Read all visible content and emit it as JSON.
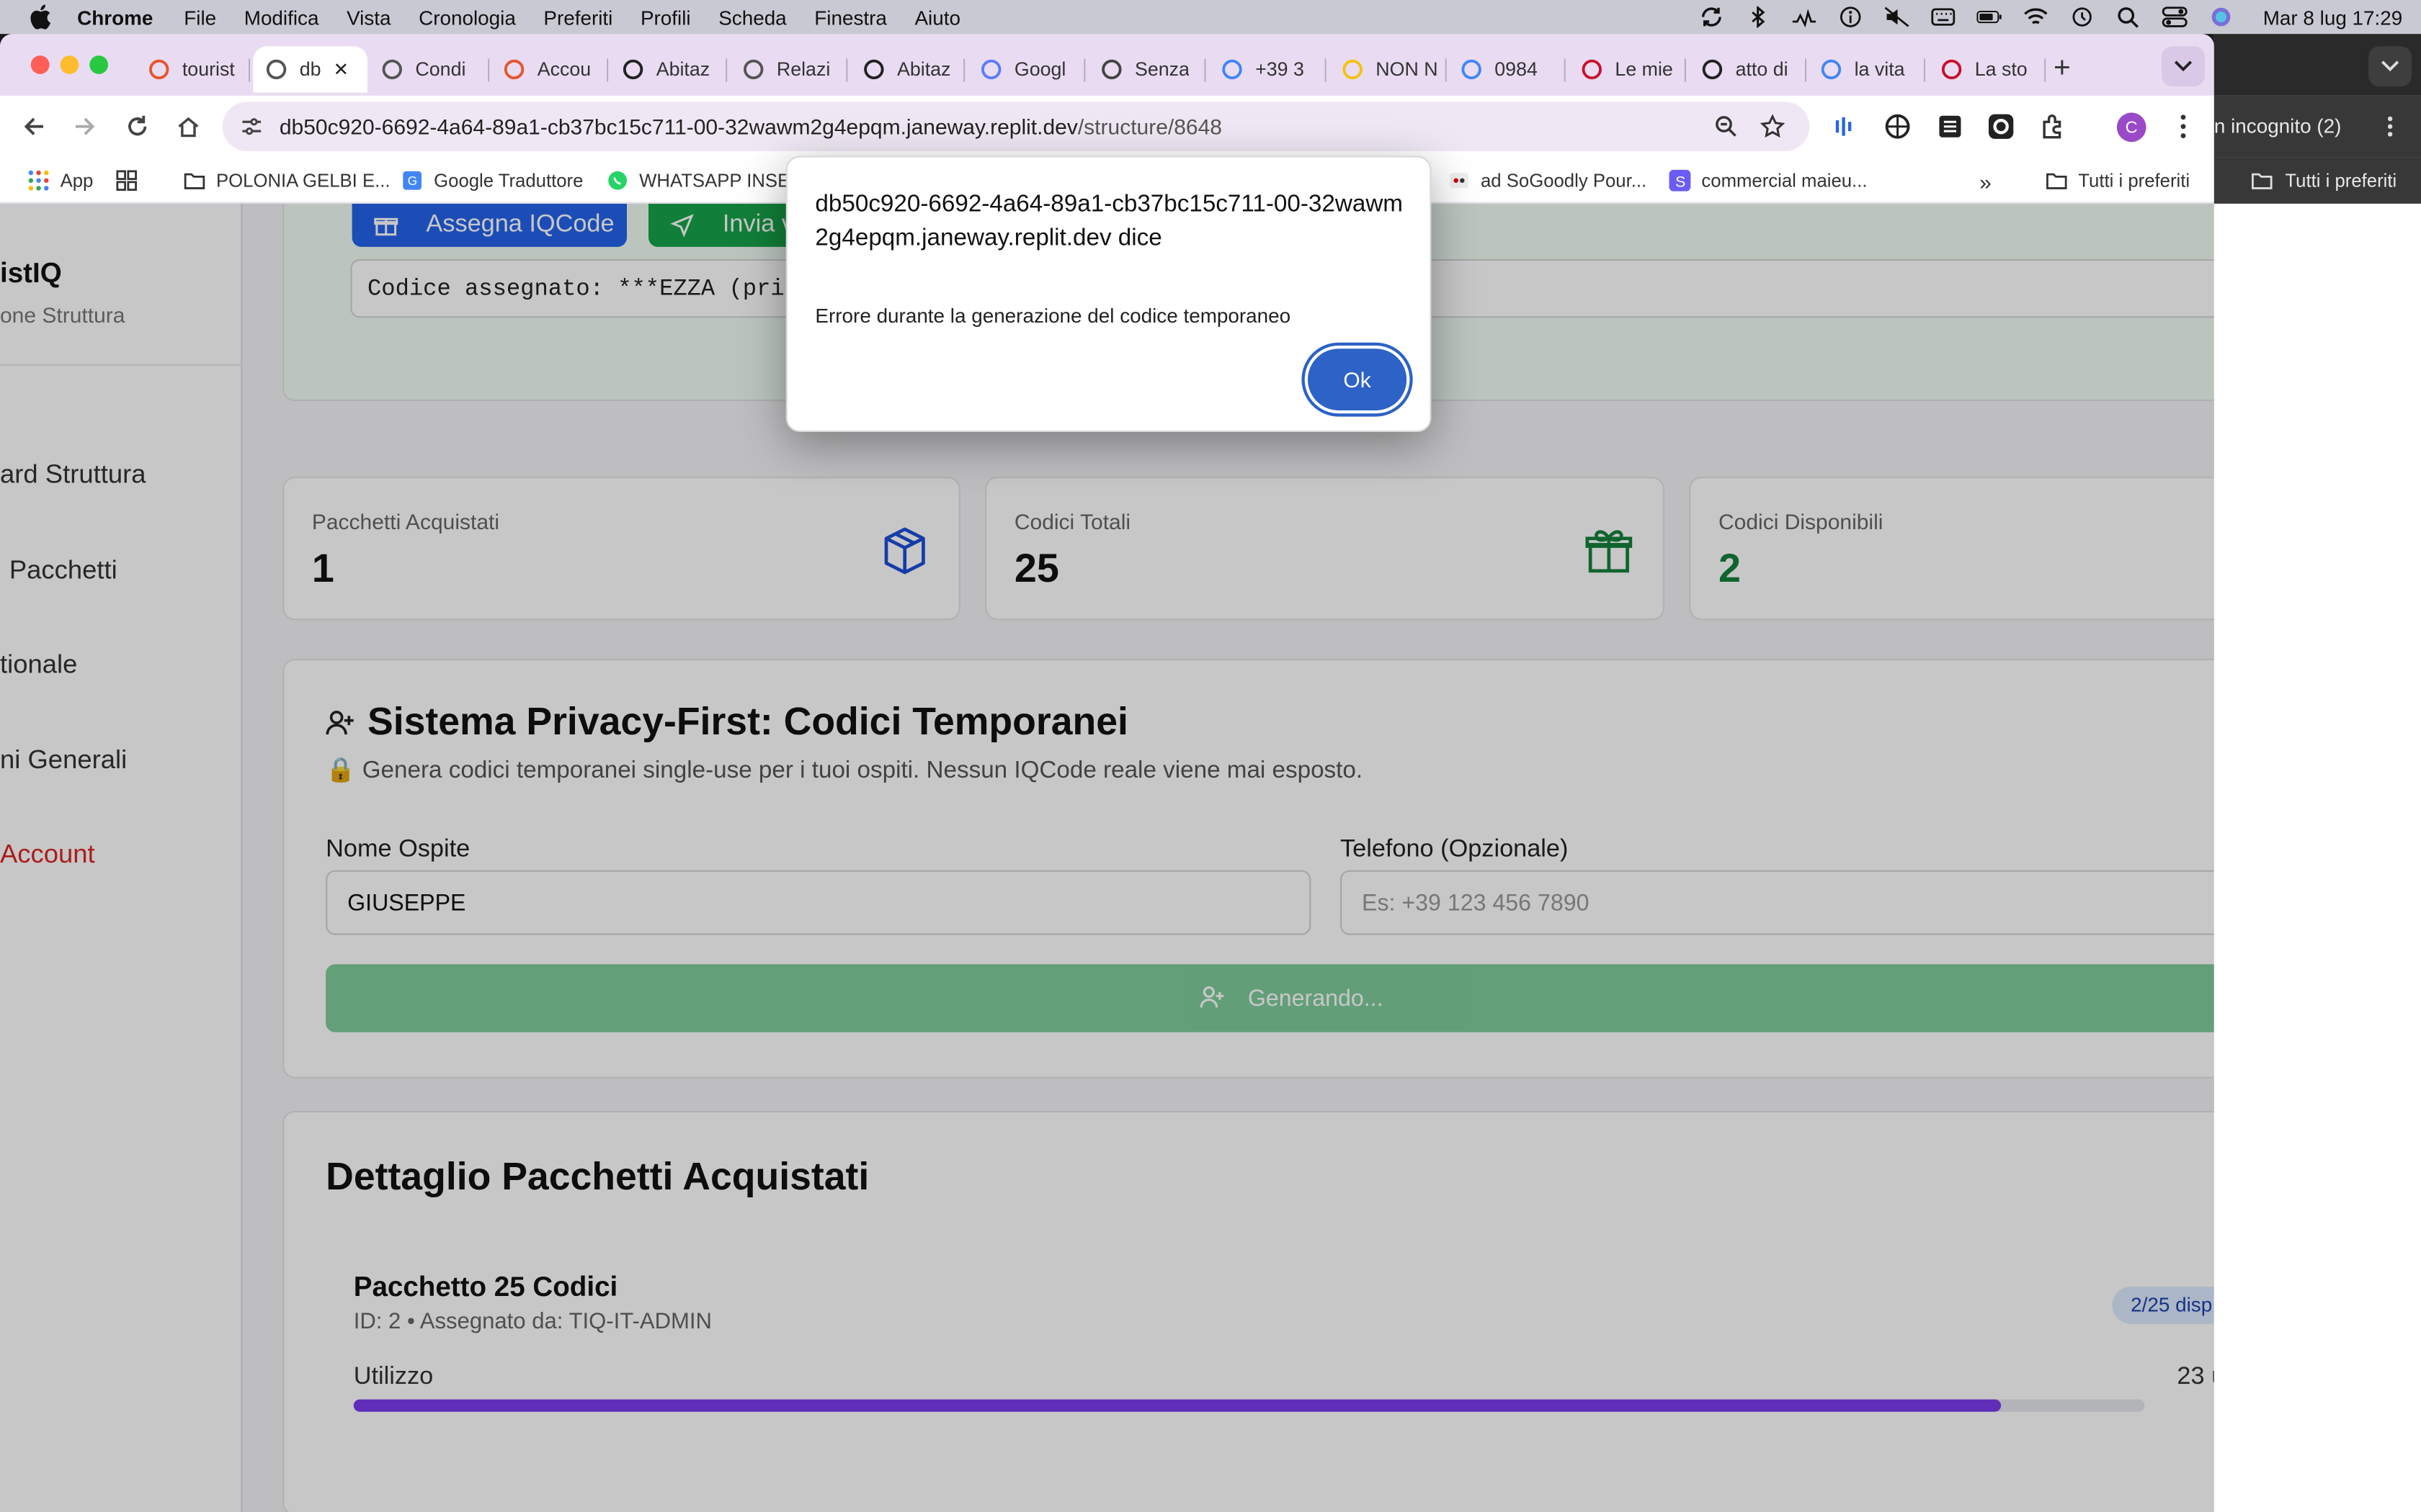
{
  "menubar": {
    "app": "Chrome",
    "items": [
      "File",
      "Modifica",
      "Vista",
      "Cronologia",
      "Preferiti",
      "Profili",
      "Scheda",
      "Finestra",
      "Aiuto"
    ],
    "clock": "Mar 8 lug  17:29"
  },
  "tabs": [
    {
      "label": "tourist",
      "active": false
    },
    {
      "label": "db",
      "active": true
    },
    {
      "label": "Condi",
      "active": false
    },
    {
      "label": "Accou",
      "active": false
    },
    {
      "label": "Abitaz",
      "active": false
    },
    {
      "label": "Relazi",
      "active": false
    },
    {
      "label": "Abitaz",
      "active": false
    },
    {
      "label": "Googl",
      "active": false
    },
    {
      "label": "Senza",
      "active": false
    },
    {
      "label": "+39 3",
      "active": false
    },
    {
      "label": "NON N",
      "active": false
    },
    {
      "label": "0984",
      "active": false
    },
    {
      "label": "Le mie",
      "active": false
    },
    {
      "label": "atto di",
      "active": false
    },
    {
      "label": "la vita",
      "active": false
    },
    {
      "label": "La sto",
      "active": false
    }
  ],
  "address": {
    "host": "db50c920-6692-4a64-89a1-cb37bc15c711-00-32wawm2g4epqm.janeway.replit.dev",
    "path": "/structure/8648"
  },
  "avatar_letter": "C",
  "bookmarks": [
    "App",
    "POLONIA GELBI E...",
    "Google Traduttore",
    "WHATSAPP INSER",
    "ad SoGoodly Pour...",
    "commercial maieu...",
    "Tutti i preferiti"
  ],
  "incognito": {
    "label": "n incognito (2)",
    "bookmarks_label": "Tutti i preferiti"
  },
  "sidebar": {
    "title": "istIQ",
    "subtitle": "one Struttura",
    "items": [
      "ard Struttura",
      "Pacchetti",
      "tionale",
      "ni Generali",
      "Account"
    ]
  },
  "assign": {
    "assign_button": "Assegna IQCode",
    "send_button": "Invia v",
    "code_text": "Codice assegnato: ***EZZA (pri"
  },
  "stats": [
    {
      "label": "Pacchetti Acquistati",
      "value": "1",
      "icon": "box-icon",
      "color": "#1d4ed8"
    },
    {
      "label": "Codici Totali",
      "value": "25",
      "icon": "gift-icon",
      "color": "#15803d"
    },
    {
      "label": "Codici Disponibili",
      "value": "2",
      "icon": "none",
      "color": "#15803d"
    }
  ],
  "privacy": {
    "title": "Sistema Privacy-First: Codici Temporanei",
    "description": "🔒 Genera codici temporanei single-use per i tuoi ospiti. Nessun IQCode reale viene mai esposto.",
    "guest_label": "Nome Ospite",
    "guest_value": "GIUSEPPE",
    "phone_label": "Telefono (Opzionale)",
    "phone_placeholder": "Es: +39 123 456 7890",
    "generate_button": "Generando..."
  },
  "details": {
    "title": "Dettaglio Pacchetti Acquistati",
    "package_title": "Pacchetto 25 Codici",
    "package_meta": "ID: 2 • Assegnato da: TIQ-IT-ADMIN",
    "badge": "2/25 disp",
    "usage_label": "Utilizzo",
    "usage_value": "23 u",
    "usage_fraction": 0.92
  },
  "dialog": {
    "title": "db50c920-6692-4a64-89a1-cb37bc15c711-00-32wawm2g4epqm.janeway.replit.dev dice",
    "message": "Errore durante la generazione del codice temporaneo",
    "ok_label": "Ok"
  }
}
